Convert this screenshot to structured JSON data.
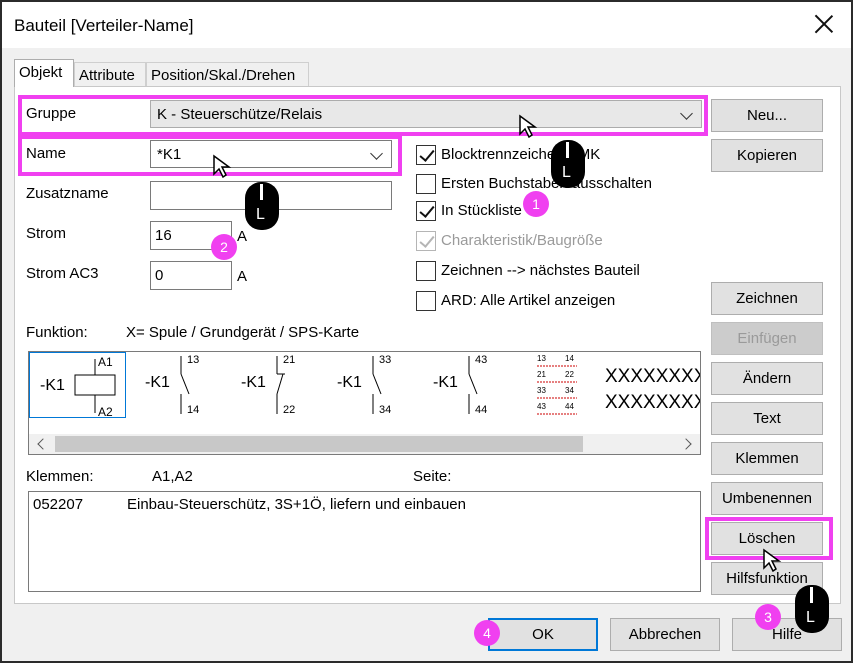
{
  "window": {
    "title": "Bauteil [Verteiler-Name]"
  },
  "tabs": [
    {
      "label": "Objekt"
    },
    {
      "label": "Attribute"
    },
    {
      "label": "Position/Skal./Drehen"
    }
  ],
  "form": {
    "gruppe_label": "Gruppe",
    "gruppe_value": "K - Steuerschütze/Relais",
    "name_label": "Name",
    "name_value": "*K1",
    "zusatzname_label": "Zusatzname",
    "zusatzname_value": "",
    "strom_label": "Strom",
    "strom_value": "16",
    "strom_unit": "A",
    "stromac3_label": "Strom AC3",
    "stromac3_value": "0",
    "stromac3_unit": "A"
  },
  "checkboxes": [
    {
      "label": "Blocktrennzeichen BMK",
      "checked": true
    },
    {
      "label": "Ersten Buchstaben ausschalten",
      "checked": false
    },
    {
      "label": "In Stückliste",
      "checked": true
    },
    {
      "label": "Charakteristik/Baugröße",
      "checked": true,
      "disabled": true
    },
    {
      "label": "Zeichnen --> nächstes Bauteil",
      "checked": false
    },
    {
      "label": "ARD: Alle Artikel anzeigen",
      "checked": false
    }
  ],
  "funktion": {
    "label": "Funktion:",
    "description": "X= Spule / Grundgerät / SPS-Karte"
  },
  "symbols": {
    "coil": {
      "name": "-K1",
      "top": "A1",
      "bottom": "A2"
    },
    "contacts": [
      {
        "name": "-K1",
        "top": "13",
        "bottom": "14"
      },
      {
        "name": "-K1",
        "top": "21",
        "bottom": "22"
      },
      {
        "name": "-K1",
        "top": "33",
        "bottom": "34"
      },
      {
        "name": "-K1",
        "top": "43",
        "bottom": "44"
      }
    ],
    "mini_rows": [
      {
        "left": "13",
        "right": "14"
      },
      {
        "left": "21",
        "right": "22"
      },
      {
        "left": "33",
        "right": "34"
      },
      {
        "left": "43",
        "right": "44"
      }
    ],
    "placeholder_line1": "XXXXXXXXX",
    "placeholder_line2": "XXXXXXXXX"
  },
  "klemmen": {
    "label": "Klemmen:",
    "value": "A1,A2",
    "seite_label": "Seite:"
  },
  "articles": [
    {
      "number": "052207",
      "description": "Einbau-Steuerschütz, 3S+1Ö, liefern und einbauen"
    }
  ],
  "buttons": {
    "neu": "Neu...",
    "kopieren": "Kopieren",
    "zeichnen": "Zeichnen",
    "einfuegen": "Einfügen",
    "aendern": "Ändern",
    "text": "Text",
    "klemmen": "Klemmen",
    "umbenennen": "Umbenennen",
    "loeschen": "Löschen",
    "hilfsfunktion": "Hilfsfunktion",
    "ok": "OK",
    "abbrechen": "Abbrechen",
    "hilfe": "Hilfe"
  },
  "annotations": {
    "badge1": "1",
    "badge2": "2",
    "badge3": "3",
    "badge4": "4",
    "mouse_letter": "L"
  },
  "colors": {
    "highlight": "#f040f0",
    "focus": "#0078d7"
  }
}
